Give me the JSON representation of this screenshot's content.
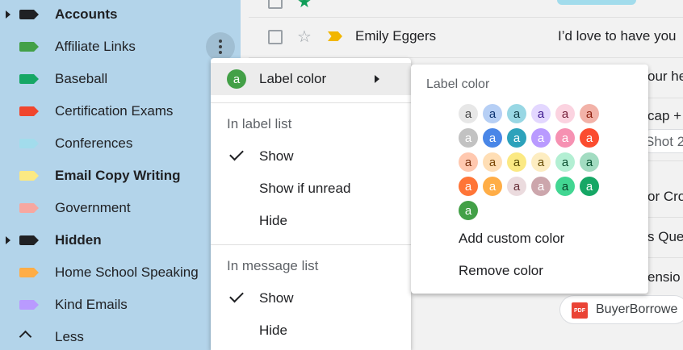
{
  "sidebar": {
    "labels": [
      {
        "name": "Accounts",
        "color": "#202124",
        "bold": true,
        "expandable": true
      },
      {
        "name": "Affiliate Links",
        "color": "#43a047",
        "bold": false,
        "expandable": false
      },
      {
        "name": "Baseball",
        "color": "#16a765",
        "bold": false,
        "expandable": false
      },
      {
        "name": "Certification Exams",
        "color": "#f0462e",
        "bold": false,
        "expandable": false
      },
      {
        "name": "Conferences",
        "color": "#a2dcec",
        "bold": false,
        "expandable": false
      },
      {
        "name": "Email Copy Writing",
        "color": "#fbe983",
        "bold": true,
        "expandable": false
      },
      {
        "name": "Government",
        "color": "#f7a7a0",
        "bold": false,
        "expandable": false
      },
      {
        "name": "Hidden",
        "color": "#202124",
        "bold": true,
        "expandable": true
      },
      {
        "name": "Home School Speaking",
        "color": "#ffad46",
        "bold": false,
        "expandable": false
      },
      {
        "name": "Kind Emails",
        "color": "#b99aff",
        "bold": false,
        "expandable": false
      }
    ],
    "less_label": "Less"
  },
  "emails": [
    {
      "sender": "Emily Eggers",
      "snippet": "I’d love to have you"
    },
    {
      "snippet": "our he"
    },
    {
      "snippet": "cap +"
    },
    {
      "snippet": "Shot 2"
    },
    {
      "snippet": "or Cro"
    },
    {
      "snippet": "s Quer"
    },
    {
      "snippet": "ensio"
    }
  ],
  "attachment_chip": {
    "label": "BuyerBorrowe",
    "icon_text": "PDF"
  },
  "context_menu": {
    "label_color": "Label color",
    "label_color_badge": "a",
    "label_color_badge_color": "#43a047",
    "in_label_list": "In label list",
    "label_list_options": [
      "Show",
      "Show if unread",
      "Hide"
    ],
    "in_message_list": "In message list",
    "message_list_options": [
      "Show",
      "Hide"
    ]
  },
  "color_submenu": {
    "title": "Label color",
    "swatch_letter": "a",
    "rows": [
      [
        [
          "#e7e7e7",
          "#464646"
        ],
        [
          "#b6cff5",
          "#0d3472"
        ],
        [
          "#98d7e4",
          "#0d3b44"
        ],
        [
          "#e3d7ff",
          "#3d188e"
        ],
        [
          "#fbd3e0",
          "#711a36"
        ],
        [
          "#f2b2a8",
          "#8a1c0a"
        ]
      ],
      [
        [
          "#c2c2c2",
          "#ffffff"
        ],
        [
          "#4986e7",
          "#ffffff"
        ],
        [
          "#2da2bb",
          "#ffffff"
        ],
        [
          "#b99aff",
          "#ffffff"
        ],
        [
          "#f691b2",
          "#ffffff"
        ],
        [
          "#fb4c2f",
          "#ffffff"
        ]
      ],
      [
        [
          "#ffc8af",
          "#7a2e0b"
        ],
        [
          "#ffdeb5",
          "#7a4706"
        ],
        [
          "#fbe983",
          "#594c05"
        ],
        [
          "#fdedc1",
          "#684e07"
        ],
        [
          "#b3efd3",
          "#0b4f30"
        ],
        [
          "#a2dcc1",
          "#04502e"
        ]
      ],
      [
        [
          "#ff7537",
          "#ffffff"
        ],
        [
          "#ffad46",
          "#ffffff"
        ],
        [
          "#ebdbde",
          "#662e37"
        ],
        [
          "#cca6ac",
          "#ffffff"
        ],
        [
          "#42d692",
          "#094228"
        ],
        [
          "#16a765",
          "#ffffff"
        ]
      ],
      [
        [
          "#43a047",
          "#ffffff"
        ]
      ]
    ],
    "add_custom": "Add custom color",
    "remove": "Remove color"
  }
}
